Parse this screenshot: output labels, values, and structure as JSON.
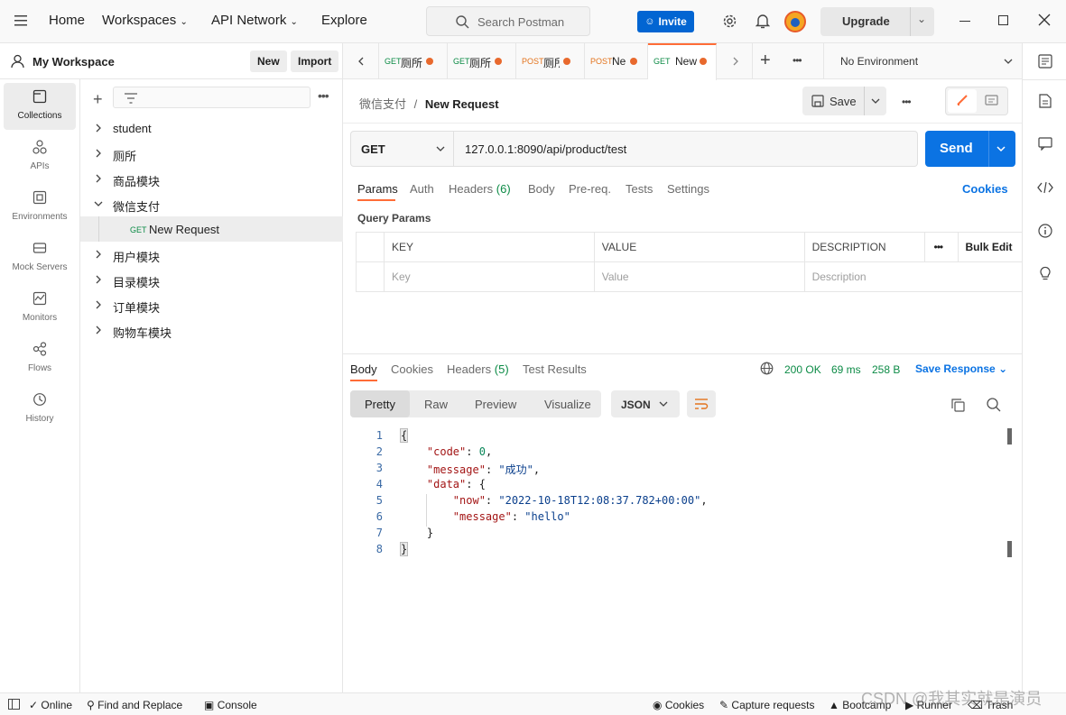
{
  "topbar": {
    "nav": [
      "Home",
      "Workspaces",
      "API Network",
      "Explore"
    ],
    "search_placeholder": "Search Postman",
    "invite": "Invite",
    "upgrade": "Upgrade"
  },
  "workspace": {
    "name": "My Workspace",
    "new": "New",
    "import": "Import"
  },
  "rail": [
    "Collections",
    "APIs",
    "Environments",
    "Mock Servers",
    "Monitors",
    "Flows",
    "History"
  ],
  "tree": {
    "items": [
      "student",
      "厕所",
      "商品模块",
      "微信支付",
      "New Request",
      "用户模块",
      "目录模块",
      "订单模块",
      "购物车模块"
    ],
    "child_method": "GET"
  },
  "tabs": [
    {
      "method": "GET",
      "title": "厕所"
    },
    {
      "method": "GET",
      "title": "厕所"
    },
    {
      "method": "POST",
      "title": "厕所"
    },
    {
      "method": "POST",
      "title": "Ne"
    },
    {
      "method": "GET",
      "title": "New"
    }
  ],
  "environment": "No Environment",
  "request": {
    "breadcrumb_parent": "微信支付",
    "breadcrumb_sep": "/",
    "name": "New Request",
    "save": "Save",
    "method": "GET",
    "url": "127.0.0.1:8090/api/product/test",
    "send": "Send"
  },
  "req_tabs": [
    "Params",
    "Auth",
    "Headers",
    "(6)",
    "Body",
    "Pre-req.",
    "Tests",
    "Settings"
  ],
  "cookies": "Cookies",
  "query_params": "Query Params",
  "params_table": {
    "headers": [
      "KEY",
      "VALUE",
      "DESCRIPTION",
      "Bulk Edit"
    ],
    "placeholders": [
      "Key",
      "Value",
      "Description"
    ]
  },
  "response": {
    "tabs": [
      "Body",
      "Cookies",
      "Headers",
      "(5)",
      "Test Results"
    ],
    "status": "200 OK",
    "time": "69 ms",
    "size": "258 B",
    "save_response": "Save Response",
    "views": [
      "Pretty",
      "Raw",
      "Preview",
      "Visualize"
    ],
    "format": "JSON",
    "lines": [
      "1",
      "2",
      "3",
      "4",
      "5",
      "6",
      "7",
      "8"
    ]
  },
  "code": {
    "l1": "{",
    "k_code": "\"code\"",
    "v_code": "0",
    "k_message": "\"message\"",
    "v_message": "\"成功\"",
    "k_data": "\"data\"",
    "v_data_open": "{",
    "k_now": "\"now\"",
    "v_now": "\"2022-10-18T12:08:37.782+00:00\"",
    "k_msg2": "\"message\"",
    "v_msg2": "\"hello\"",
    "l7": "}",
    "l8": "}"
  },
  "statusbar": [
    "Online",
    "Find and Replace",
    "Console",
    "Cookies",
    "Capture requests",
    "Bootcamp",
    "Runner",
    "Trash"
  ],
  "watermark": "CSDN @我其实就是演员",
  "colors": {
    "accent": "#ff6c37",
    "send": "#0b73e3",
    "get": "#0c8b46",
    "post": "#e3731c"
  }
}
